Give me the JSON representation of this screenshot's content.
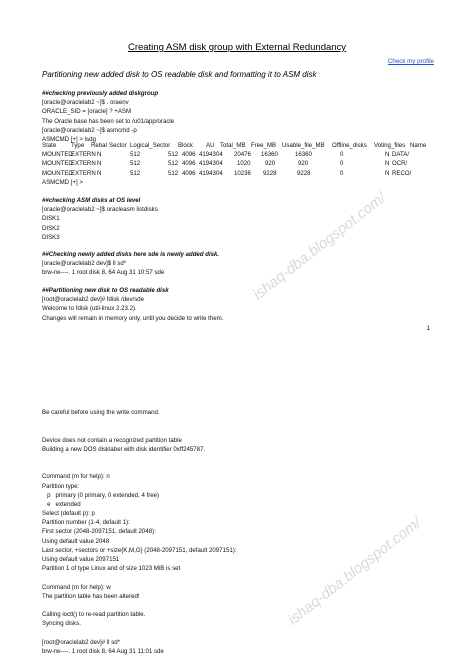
{
  "header": {
    "title": "Creating ASM disk group with External Redundancy",
    "profile_link": "Check my profile"
  },
  "subtitle": "Partitioning new added disk to OS readable disk and formatting it to ASM disk",
  "section1": {
    "heading": "##checking previously added diskgroup",
    "lines": [
      "[oracle@oraclelab2 ~]$ . oraenv",
      "ORACLE_SID = [oracle] ? +ASM",
      "The Oracle base has been set to /u01/app/oracle",
      "[oracle@oraclelab2 ~]$ asmcmd -p",
      "ASMCMD [+] > lsdg"
    ]
  },
  "lsdg_table": {
    "columns": [
      "State",
      "Type",
      "Rebal",
      "Sector",
      "Logical_Sector",
      "Block",
      "AU",
      "Total_MB",
      "Free_MB",
      "Usable_file_MB",
      "Offline_disks",
      "Voting_files",
      "Name"
    ],
    "rows": [
      [
        "MOUNTED",
        "EXTERN",
        "N",
        "512",
        "512",
        "4096",
        "4194304",
        "20476",
        "16360",
        "16360",
        "0",
        "N",
        "DATA/"
      ],
      [
        "MOUNTED",
        "EXTERN",
        "N",
        "512",
        "512",
        "4096",
        "4194304",
        "1020",
        "920",
        "920",
        "0",
        "N",
        "OCR/"
      ],
      [
        "MOUNTED",
        "EXTERN",
        "N",
        "512",
        "512",
        "4096",
        "4194304",
        "10236",
        "9228",
        "9228",
        "0",
        "N",
        "RECO/"
      ]
    ],
    "prompt": "ASMCMD [+] >"
  },
  "section2": {
    "heading": "##checking ASM disks at OS level",
    "lines": [
      "[oracle@oraclelab2 ~]$ oracleasm listdisks",
      "DISK1",
      "DISK2",
      "DISK3"
    ]
  },
  "section3": {
    "heading": "##Checking newly added disks here sde is newly added disk.",
    "lines": [
      "[oracle@oraclelab2 dev]$ ll sd*",
      "brw-rw----. 1 root disk 8, 64 Aug 31 10:57 sde"
    ]
  },
  "section4": {
    "heading": "##Partitioning new disk to OS readable disk",
    "lines": [
      "[root@oraclelab2 dev]# fdisk /dev/sde",
      "Welcome to fdisk (util-linux 2.23.2).",
      "Changes will remain in memory only, until you decide to write them."
    ]
  },
  "page_number": "1",
  "section5": {
    "lines": [
      "Be careful before using the write command.",
      "",
      "",
      "Device does not contain a recognized partition table",
      "Building a new DOS disklabel with disk identifier 0xff245787.",
      "",
      "",
      "Command (m for help): n",
      "Partition type:",
      "   p   primary (0 primary, 0 extended, 4 free)",
      "   e   extended",
      "Select (default p): p",
      "Partition number (1-4, default 1):",
      "First sector (2048-2097151, default 2048):",
      "Using default value 2048",
      "Last sector, +sectors or +size{K,M,G} (2048-2097151, default 2097151):",
      "Using default value 2097151",
      "Partition 1 of type Linux and of size 1023 MiB is set",
      "",
      "Command (m for help): w",
      "The partition table has been altered!",
      "",
      "Calling ioctl() to re-read partition table.",
      "Syncing disks.",
      "",
      "[root@oraclelab2 dev]# ll sd*",
      "brw-rw----. 1 root disk 8, 64 Aug 31 11:01 sde"
    ]
  },
  "watermark": {
    "text": "ishaq-dba.blogspot.com/",
    "color": "#d9d9d9"
  }
}
